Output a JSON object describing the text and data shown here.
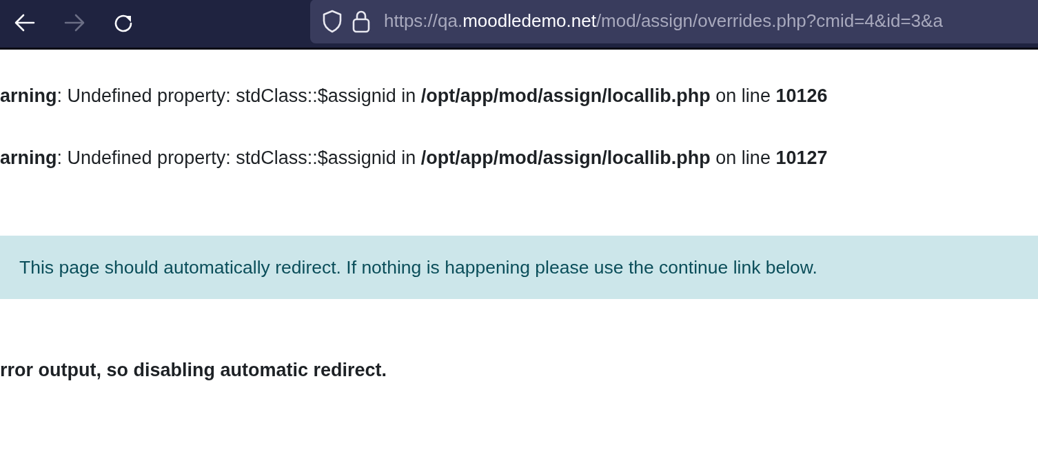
{
  "toolbar": {
    "nav_buttons": [
      {
        "kind": "back",
        "disabled": false
      },
      {
        "kind": "forward",
        "disabled": true
      },
      {
        "kind": "reload",
        "disabled": false
      }
    ],
    "url": {
      "prefix": "https://qa.",
      "domain": "moodledemo.net",
      "path": "/mod/assign/overrides.php?cmid=4&id=3&a"
    }
  },
  "warnings": [
    {
      "label": "arning",
      "message": ": Undefined property: stdClass::$assignid in ",
      "file": "/opt/app/mod/assign/locallib.php",
      "line_label": " on line ",
      "line": "10126"
    },
    {
      "label": "arning",
      "message": ": Undefined property: stdClass::$assignid in ",
      "file": "/opt/app/mod/assign/locallib.php",
      "line_label": " on line ",
      "line": "10127"
    }
  ],
  "alert": {
    "text": "This page should automatically redirect. If nothing is happening please use the continue link below."
  },
  "error": {
    "text": "rror output, so disabling automatic redirect."
  }
}
